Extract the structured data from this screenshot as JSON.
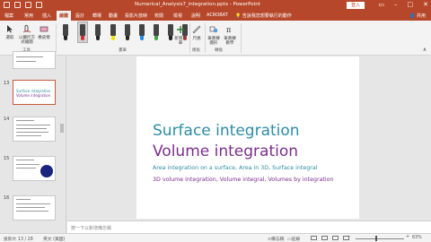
{
  "app": {
    "title": "Numerical_Analysis7_integration.pptx  -  PowerPoint",
    "login_label": "登入"
  },
  "ribbon_tabs": [
    {
      "label": "檔案"
    },
    {
      "label": "常用"
    },
    {
      "label": "插入"
    },
    {
      "label": "繪圖",
      "active": true
    },
    {
      "label": "設計"
    },
    {
      "label": "轉場"
    },
    {
      "label": "動畫"
    },
    {
      "label": "投影片放映"
    },
    {
      "label": "校閱"
    },
    {
      "label": "檢視"
    },
    {
      "label": "說明"
    },
    {
      "label": "ACROBAT"
    }
  ],
  "tellme": "告訴我您想要執行的動作",
  "share": "共用",
  "ribbon": {
    "tools": [
      {
        "label": "選取",
        "icon": "select-cursor-icon"
      },
      {
        "label": "以觸控方式繪圖",
        "icon": "touch-draw-icon"
      },
      {
        "label": "橡皮擦",
        "icon": "eraser-icon"
      }
    ],
    "pens": [
      {
        "color": "#222222",
        "selected": false
      },
      {
        "color": "#d32f2f",
        "selected": true
      },
      {
        "color": "#222222",
        "selected": false
      },
      {
        "color": "#f2e600",
        "selected": false
      },
      {
        "color": "#222222",
        "selected": false
      },
      {
        "color": "#1e88e5",
        "selected": false
      },
      {
        "color": "#43a047",
        "selected": false
      },
      {
        "color": "#222222",
        "selected": false
      },
      {
        "color": "#e53935",
        "selected": false
      }
    ],
    "add_pen": {
      "label": "新增畫筆",
      "icon": "add-pen-icon"
    },
    "ruler": {
      "label": "尺規",
      "icon": "ruler-icon"
    },
    "ink_to_shape": {
      "label": "筆墨轉圖形",
      "icon": "ink-to-shape-icon"
    },
    "ink_to_math": {
      "label": "筆墨轉數學",
      "icon": "ink-to-math-icon"
    },
    "groups": {
      "tools": "工具",
      "pens": "畫筆",
      "stencils": "模板",
      "convert": "轉換"
    }
  },
  "thumbnails": [
    {
      "number": "",
      "selected": false
    },
    {
      "number": "13",
      "selected": true
    },
    {
      "number": "14",
      "selected": false
    },
    {
      "number": "15",
      "selected": false
    },
    {
      "number": "16",
      "selected": false
    }
  ],
  "slide": {
    "title_line1": "Surface integration",
    "title_line2": "Volume integration",
    "subtitle_line1": "Area integration on a surface, Area in 3D, Surface integral",
    "subtitle_line2": "3D volume integration, Volume integral, Volumes by integration",
    "title1_color": "#2e8ca6",
    "title2_color": "#7b2e8c"
  },
  "notes_placeholder": "按一下以新增備忘稿",
  "status": {
    "slide_indicator": "投影片 13 / 28",
    "language": "英文 (美國)",
    "notes_label": "備忘稿",
    "comments_label": "註解",
    "zoom": "63%"
  }
}
